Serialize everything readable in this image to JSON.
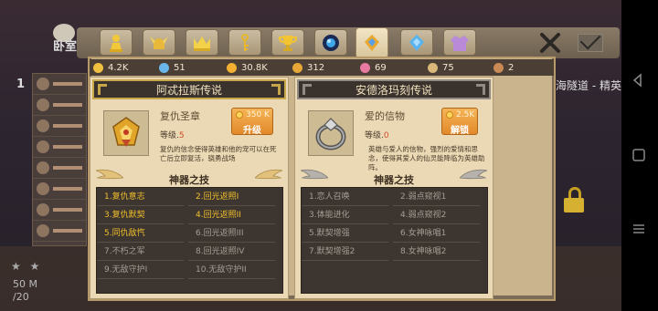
{
  "background": {
    "left_title": "卧室",
    "row_number": "1",
    "right_text": "海隧道 - 精英",
    "bottom_left_line1": "50 M",
    "bottom_left_line2": "/20",
    "stars": "★ ★"
  },
  "tabs": [
    {
      "icon": "pawn-icon",
      "active": false
    },
    {
      "icon": "viking-helmet-icon",
      "active": false
    },
    {
      "icon": "crown-icon",
      "active": false
    },
    {
      "icon": "key-icon",
      "active": false
    },
    {
      "icon": "trophy-icon",
      "active": false
    },
    {
      "icon": "orb-icon",
      "active": false
    },
    {
      "icon": "amulet-icon",
      "active": true
    },
    {
      "icon": "gem-icon",
      "active": false
    },
    {
      "icon": "shirt-icon",
      "active": false
    }
  ],
  "currency": [
    {
      "icon": "coin-stack-icon",
      "value": "4.2K",
      "color": "#f0c040"
    },
    {
      "icon": "crystal-icon",
      "value": "51",
      "color": "#6ab6ea"
    },
    {
      "icon": "gold-coin-icon",
      "value": "30.8K",
      "color": "#f4b030"
    },
    {
      "icon": "star-token-icon",
      "value": "312",
      "color": "#e8a838"
    },
    {
      "icon": "pink-gem-icon",
      "value": "69",
      "color": "#e87aa0"
    },
    {
      "icon": "feather-icon",
      "value": "75",
      "color": "#d9b87a"
    },
    {
      "icon": "disc-icon",
      "value": "2",
      "color": "#c98a56"
    }
  ],
  "cards": [
    {
      "header": "阿忒拉斯传说",
      "item_name": "复仇圣章",
      "level_label": "等级.",
      "level": "5",
      "desc": "复仇的信念使得英雄和他的宠可以在死亡后立即复活，骁勇战场",
      "button_cost": "350 K",
      "button_label": "升级",
      "skill_title": "神器之技",
      "skills": [
        {
          "text": "1.复仇意志",
          "active": true
        },
        {
          "text": "2.回光返照I",
          "active": true
        },
        {
          "text": "3.复仇默契",
          "active": true
        },
        {
          "text": "4.回光返照II",
          "active": true
        },
        {
          "text": "5.同仇敌忾",
          "active": true
        },
        {
          "text": "6.回光返照III",
          "active": false
        },
        {
          "text": "7.不朽之军",
          "active": false
        },
        {
          "text": "8.回光返照IV",
          "active": false
        },
        {
          "text": "9.无敌守护I",
          "active": false
        },
        {
          "text": "10.无敌守护II",
          "active": false
        }
      ]
    },
    {
      "header": "安德洛玛刻传说",
      "item_name": "爱的信物",
      "level_label": "等级.",
      "level": "0",
      "desc": "英雄与爱人的信物，强烈的爱情和思念，使得其爱人的仙灵能降临为英雄助阵。",
      "button_cost": "2.5K",
      "button_label": "解锁",
      "skill_title": "神器之技",
      "skills": [
        {
          "text": "1.恋人召唤",
          "active": false
        },
        {
          "text": "2.弱点窥视1",
          "active": false
        },
        {
          "text": "3.体能进化",
          "active": false
        },
        {
          "text": "4.弱点窥视2",
          "active": false
        },
        {
          "text": "5.默契增强",
          "active": false
        },
        {
          "text": "6.女神咏唱1",
          "active": false
        },
        {
          "text": "7.默契增强2",
          "active": false
        },
        {
          "text": "8.女神咏唱2",
          "active": false
        }
      ]
    }
  ]
}
